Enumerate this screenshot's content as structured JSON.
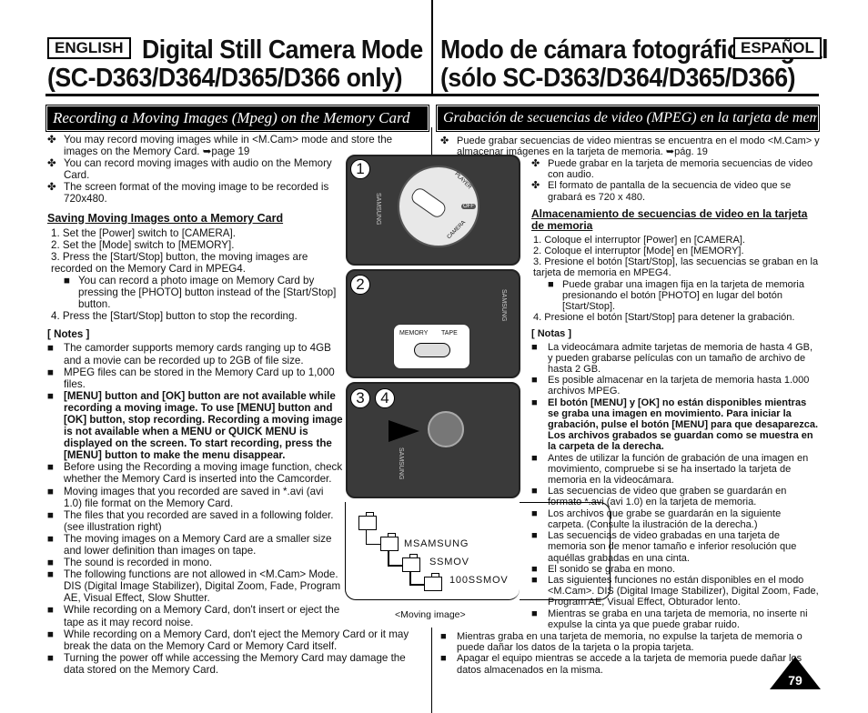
{
  "header": {
    "lang_en": "ENGLISH",
    "lang_es": "ESPAÑOL",
    "title_en_1": "Digital Still Camera Mode",
    "title_en_2": "(SC-D363/D364/D365/D366 only)",
    "title_es_1": "Modo de cámara fotográfica digital",
    "title_es_2": "(sólo SC-D363/D364/D365/D366)"
  },
  "section": {
    "en": "Recording a Moving Images (Mpeg) on the Memory Card",
    "es": "Grabación de secuencias de video (MPEG) en la tarjeta de memoria"
  },
  "icons": {
    "bullet": "✤",
    "square": "■",
    "arrow": "➥"
  },
  "en": {
    "intro": [
      "You may record moving images while in <M.Cam> mode and store the images on the Memory Card. ➥page 19",
      "You can record moving images with audio on the Memory Card.",
      "The screen format of the moving image to be recorded is 720x480."
    ],
    "heading": "Saving Moving Images onto a Memory Card",
    "steps": [
      "1. Set the [Power] switch to [CAMERA].",
      "2. Set the [Mode] switch to [MEMORY].",
      "3. Press the [Start/Stop] button, the moving images are recorded on the Memory Card in MPEG4.",
      "You can record a photo image on Memory Card by pressing the [PHOTO] button instead of the [Start/Stop] button.",
      "4. Press the [Start/Stop] button to stop the recording."
    ],
    "notes_title": "[ Notes ]",
    "notes": [
      "The camorder supports memory cards ranging up to 4GB and a movie can be recorded up to 2GB of file size.",
      "MPEG files can be stored in the Memory Card up to 1,000 files.",
      "[MENU] button and [OK] button are not available while recording a moving image. To use [MENU] button and [OK] button, stop recording. Recording a moving image is not available when a MENU or QUICK MENU is displayed on the screen. To start recording, press the [MENU] button to make the menu disappear.",
      "Before using the Recording a moving image function, check whether the Memory Card is inserted into the Camcorder.",
      "Moving images that you recorded are saved in *.avi (avi 1.0) file format on the Memory Card.",
      "The files that you recorded are saved in a following folder. (see illustration right)",
      "The moving images on a Memory Card are a smaller size and lower definition than images on tape.",
      "The sound is recorded in mono.",
      "The following functions are not allowed in <M.Cam> Mode. DIS (Digital Image Stabilizer), Digital Zoom, Fade, Program AE, Visual Effect, Slow Shutter.",
      "While recording on a Memory Card, don't insert or eject the tape as it may record noise.",
      "While recording on a Memory Card, don't eject the Memory Card or it may break the data on the Memory Card or Memory Card itself.",
      "Turning the power off while accessing the Memory Card may damage the data stored on the Memory Card."
    ]
  },
  "es": {
    "intro": [
      "Puede grabar secuencias de video mientras se encuentra en el modo <M.Cam> y almacenar imágenes en la tarjeta de memoria. ➥pág. 19",
      "Puede grabar en la tarjeta de memoria secuencias de video con audio.",
      "El formato de pantalla de la secuencia de video que se grabará es 720 x 480."
    ],
    "heading": "Almacenamiento de secuencias de video en la tarjeta de memoria",
    "steps": [
      "1. Coloque el interruptor [Power] en [CAMERA].",
      "2. Coloque el interruptor [Mode] en [MEMORY].",
      "3. Presione el botón [Start/Stop], las secuencias se graban en la tarjeta de memoria en MPEG4.",
      "Puede grabar una imagen fija en la tarjeta de memoria presionando el botón [PHOTO] en lugar del botón [Start/Stop].",
      "4. Presione el botón [Start/Stop] para detener la grabación."
    ],
    "notes_title": "[ Notas ]",
    "notes": [
      "La videocámara admite tarjetas de memoria de hasta 4 GB, y pueden grabarse películas con un tamaño de archivo de hasta 2 GB.",
      "Es posible almacenar en la tarjeta de memoria hasta 1.000 archivos MPEG.",
      "El botón [MENU] y [OK] no están disponibles mientras se graba una imagen en movimiento. Para iniciar la grabación, pulse el botón [MENU] para que desaparezca. Los archivos grabados se guardan como se muestra en la carpeta de la derecha.",
      "Antes de utilizar la función de grabación de una imagen en movimiento, compruebe si se ha insertado la tarjeta de memoria en la videocámara.",
      "Las secuencias de video que graben se guardarán en formato *.avi (avi 1.0) en la tarjeta de memoria.",
      "Los archivos que grabe se guardarán en la siguiente carpeta. (Consulte la ilustración de la derecha.)",
      "Las secuencias de video grabadas en una tarjeta de memoria son de menor tamaño e inferior resolución que aquéllas grabadas en una cinta.",
      "El sonido se graba en mono.",
      "Las siguientes funciones no están disponibles en el modo <M.Cam>. DIS (Digital Image Stabilizer), Digital Zoom, Fade, Program AE, Visual Effect, Obturador lento.",
      "Mientras se graba en una tarjeta de memoria, no inserte ni expulse la cinta ya que puede grabar ruido.",
      "Mientras graba en una tarjeta de memoria, no expulse la tarjeta de memoria o puede dañar los datos de la tarjeta o la propia tarjeta.",
      "Apagar el equipo mientras se accede a la tarjeta de memoria puede dañar los datos almacenados en la misma."
    ]
  },
  "figures": {
    "step1": "1",
    "step2": "2",
    "step3": "3",
    "step4": "4",
    "dial_player": "PLAYER",
    "dial_off": "OFF",
    "dial_camera": "CAMERA",
    "switch_memory": "MEMORY",
    "switch_tape": "TAPE",
    "brand": "SAMSUNG",
    "folders": [
      "MSAMSUNG",
      "SSMOV",
      "100SSMOV"
    ],
    "caption": "<Moving image>"
  },
  "page_number": "79"
}
